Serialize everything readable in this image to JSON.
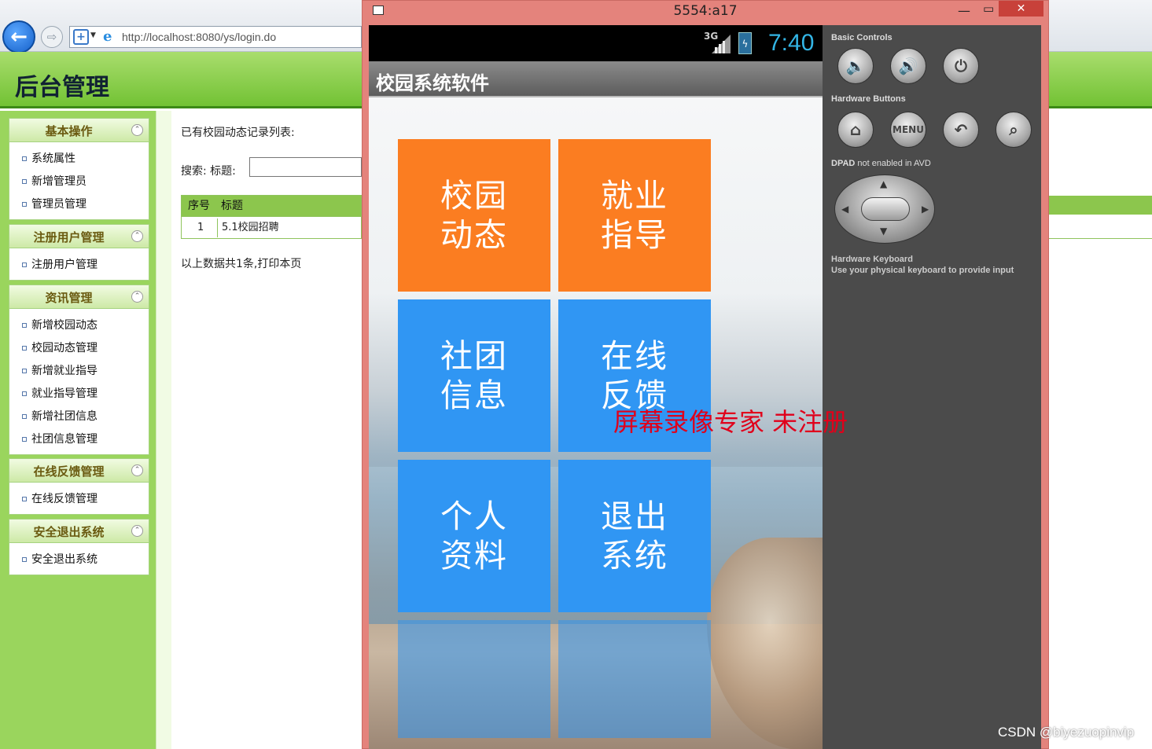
{
  "browser": {
    "url": "http://localhost:8080/ys/login.do"
  },
  "page": {
    "title": "后台管理",
    "nav_groups": [
      {
        "title": "基本操作",
        "items": [
          "系统属性",
          "新增管理员",
          "管理员管理"
        ]
      },
      {
        "title": "注册用户管理",
        "items": [
          "注册用户管理"
        ]
      },
      {
        "title": "资讯管理",
        "items": [
          "新增校园动态",
          "校园动态管理",
          "新增就业指导",
          "就业指导管理",
          "新增社团信息",
          "社团信息管理"
        ]
      },
      {
        "title": "在线反馈管理",
        "items": [
          "在线反馈管理"
        ]
      },
      {
        "title": "安全退出系统",
        "items": [
          "安全退出系统"
        ]
      }
    ],
    "list_title": "已有校园动态记录列表:",
    "search_label": "搜索:  标题:",
    "search_value": "",
    "table": {
      "headers": [
        "序号",
        "标题"
      ],
      "rows": [
        [
          "1",
          "5.1校园招聘"
        ]
      ]
    },
    "summary": "以上数据共1条,打印本页"
  },
  "emulator": {
    "window_title": "5554:a17",
    "status": {
      "network": "3G",
      "time": "7:40"
    },
    "app_title": "校园系统软件",
    "tiles": [
      {
        "label": "校园\n动态",
        "color": "#fb7d21"
      },
      {
        "label": "就业\n指导",
        "color": "#fb7d21"
      },
      {
        "label": "社团\n信息",
        "color": "#3096f3"
      },
      {
        "label": "在线\n反馈",
        "color": "#3096f3"
      },
      {
        "label": "个人\n资料",
        "color": "#3096f3"
      },
      {
        "label": "退出\n系统",
        "color": "#3096f3"
      }
    ],
    "controls": {
      "basic_label": "Basic Controls",
      "hardware_label": "Hardware Buttons",
      "menu_label": "MENU",
      "dpad_label_bold": "DPAD",
      "dpad_label_rest": " not enabled in AVD",
      "keyboard_label": "Hardware Keyboard",
      "keyboard_hint": "Use your physical keyboard to provide input"
    }
  },
  "watermark": "屏幕录像专家  未注册",
  "csdn_watermark": "CSDN @biyezuopinvip"
}
